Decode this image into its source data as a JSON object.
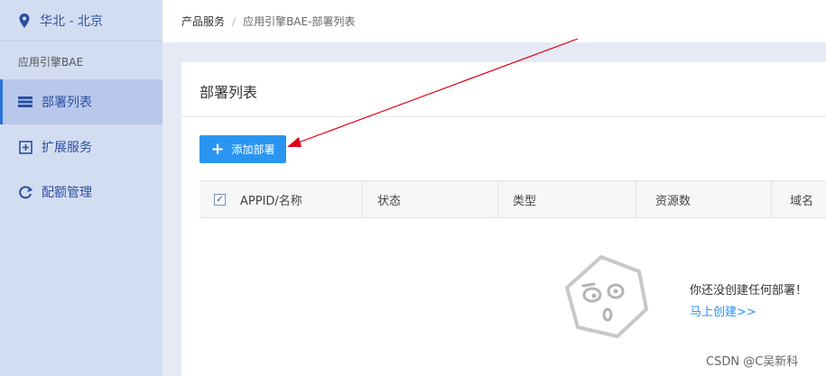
{
  "sidebar": {
    "region": "华北 - 北京",
    "section_label": "应用引擎BAE",
    "items": [
      {
        "label": "部署列表",
        "icon": "list-icon",
        "active": true
      },
      {
        "label": "扩展服务",
        "icon": "plus-square-icon",
        "active": false
      },
      {
        "label": "配额管理",
        "icon": "refresh-icon",
        "active": false
      }
    ]
  },
  "breadcrumb": {
    "root": "产品服务",
    "separator": "/",
    "current": "应用引擎BAE-部署列表"
  },
  "main": {
    "title": "部署列表",
    "add_button_label": "添加部署",
    "table": {
      "columns": [
        "APPID/名称",
        "状态",
        "类型",
        "资源数",
        "域名"
      ],
      "rows": []
    },
    "empty_message": "你还没创建任何部署！",
    "empty_link": "马上创建>>"
  },
  "watermark": "CSDN @C吴新科",
  "colors": {
    "sidebar_bg": "#d3ddf2",
    "accent": "#2a95f0",
    "link": "#2a8ff0",
    "annotation_arrow": "#e0001a"
  }
}
